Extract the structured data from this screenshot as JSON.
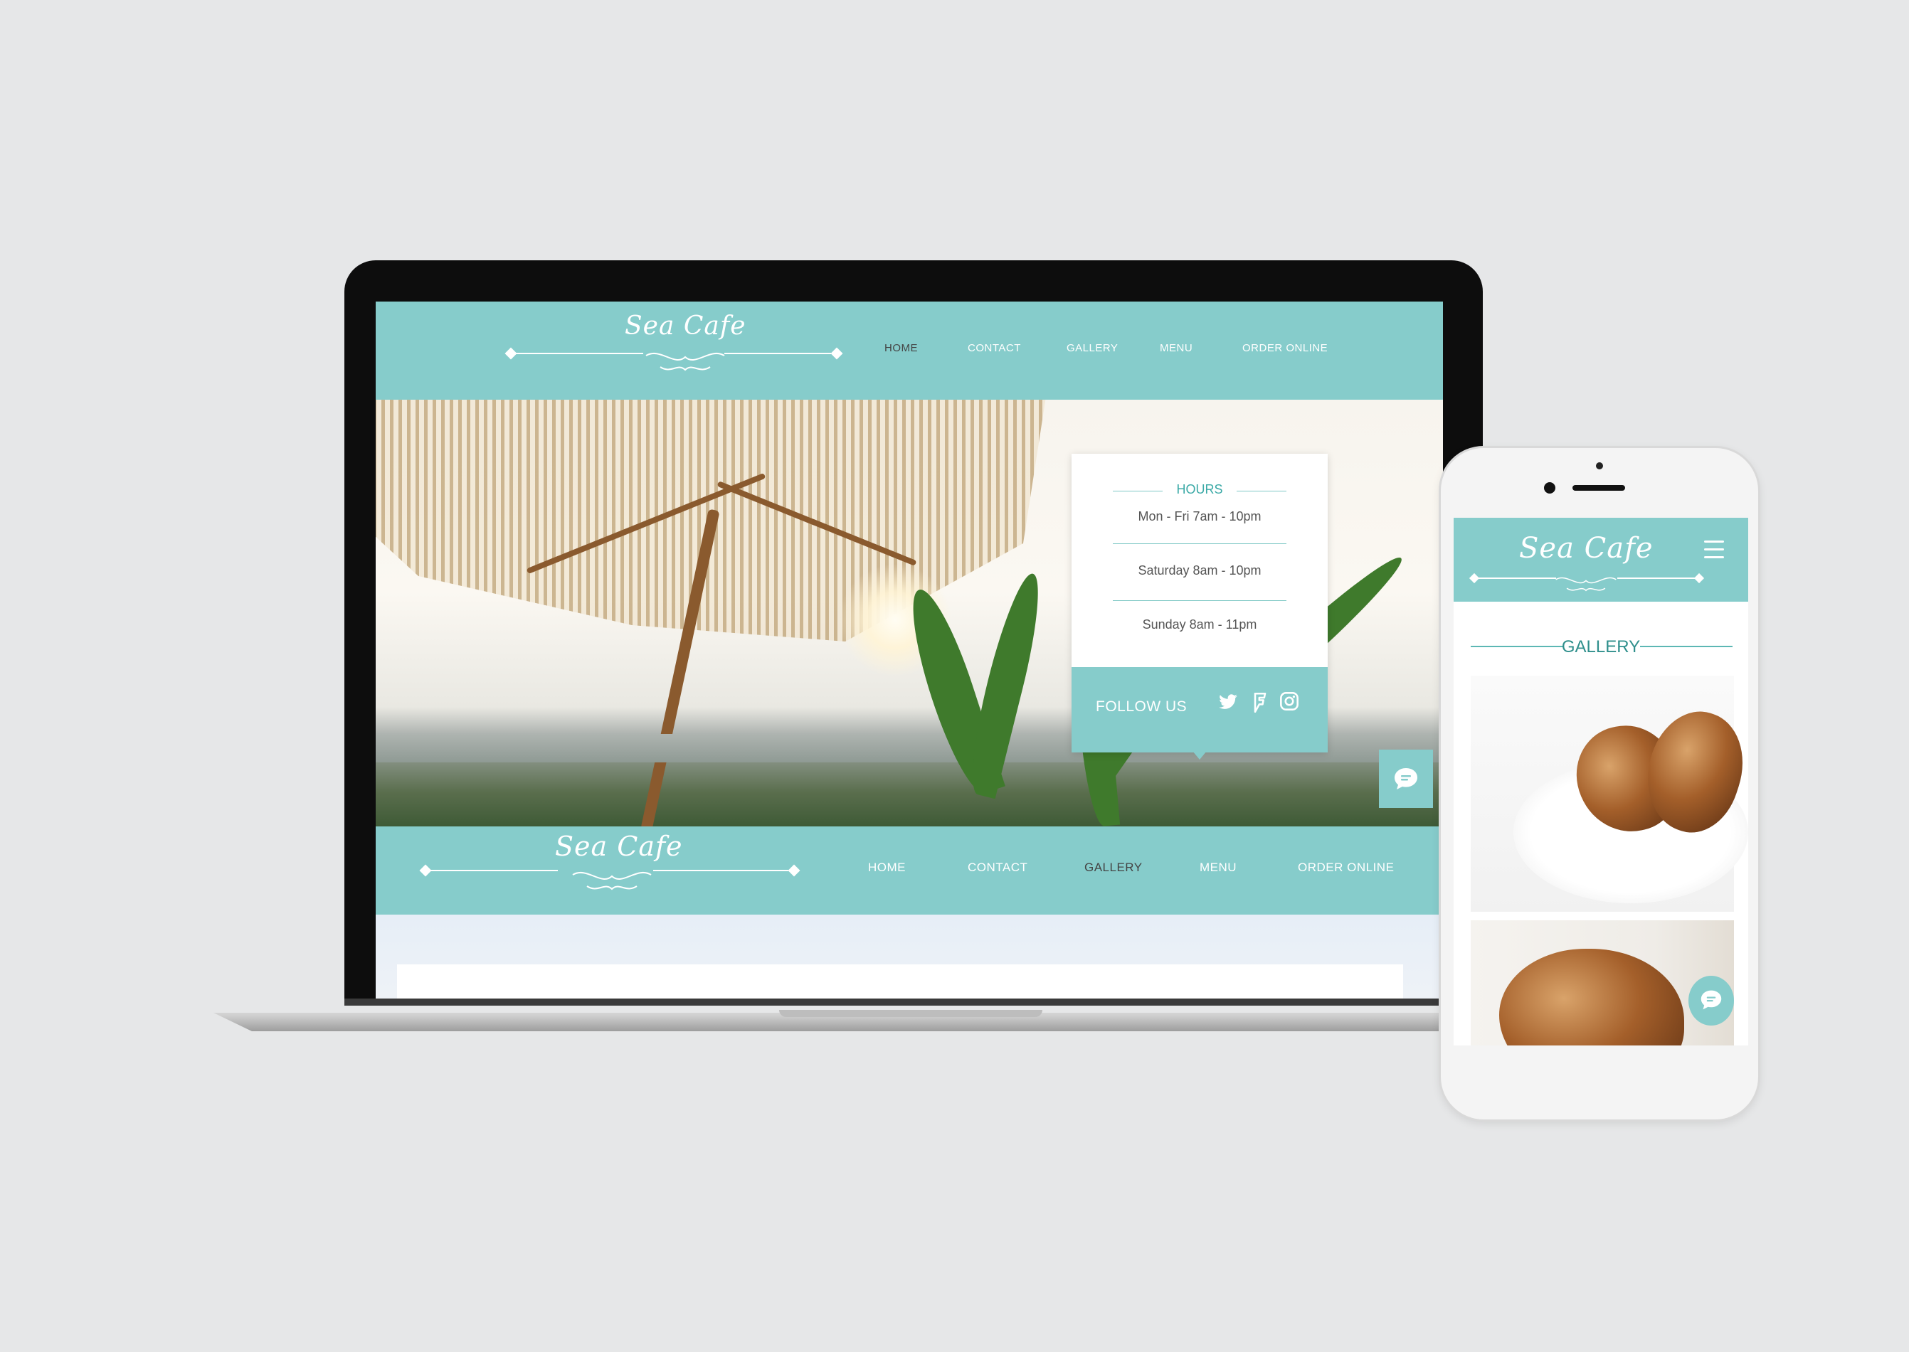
{
  "brand": {
    "name": "Sea Cafe",
    "accent_color": "#86cccb",
    "accent_dark": "#3aa9a6"
  },
  "desktop": {
    "nav": {
      "items": [
        "HOME",
        "CONTACT",
        "GALLERY",
        "MENU",
        "ORDER ONLINE"
      ]
    },
    "hours_card": {
      "title": "HOURS",
      "lines": [
        "Mon - Fri 7am - 10pm",
        "Saturday 8am - 10pm",
        "Sunday 8am - 11pm"
      ],
      "follow_label": "FOLLOW US",
      "social_icons": [
        "twitter-icon",
        "foursquare-icon",
        "instagram-icon"
      ]
    },
    "chat_icon": "chat-bubble-icon"
  },
  "mobile": {
    "section_title": "GALLERY",
    "menu_icon": "hamburger-icon",
    "chat_icon": "chat-bubble-icon"
  }
}
